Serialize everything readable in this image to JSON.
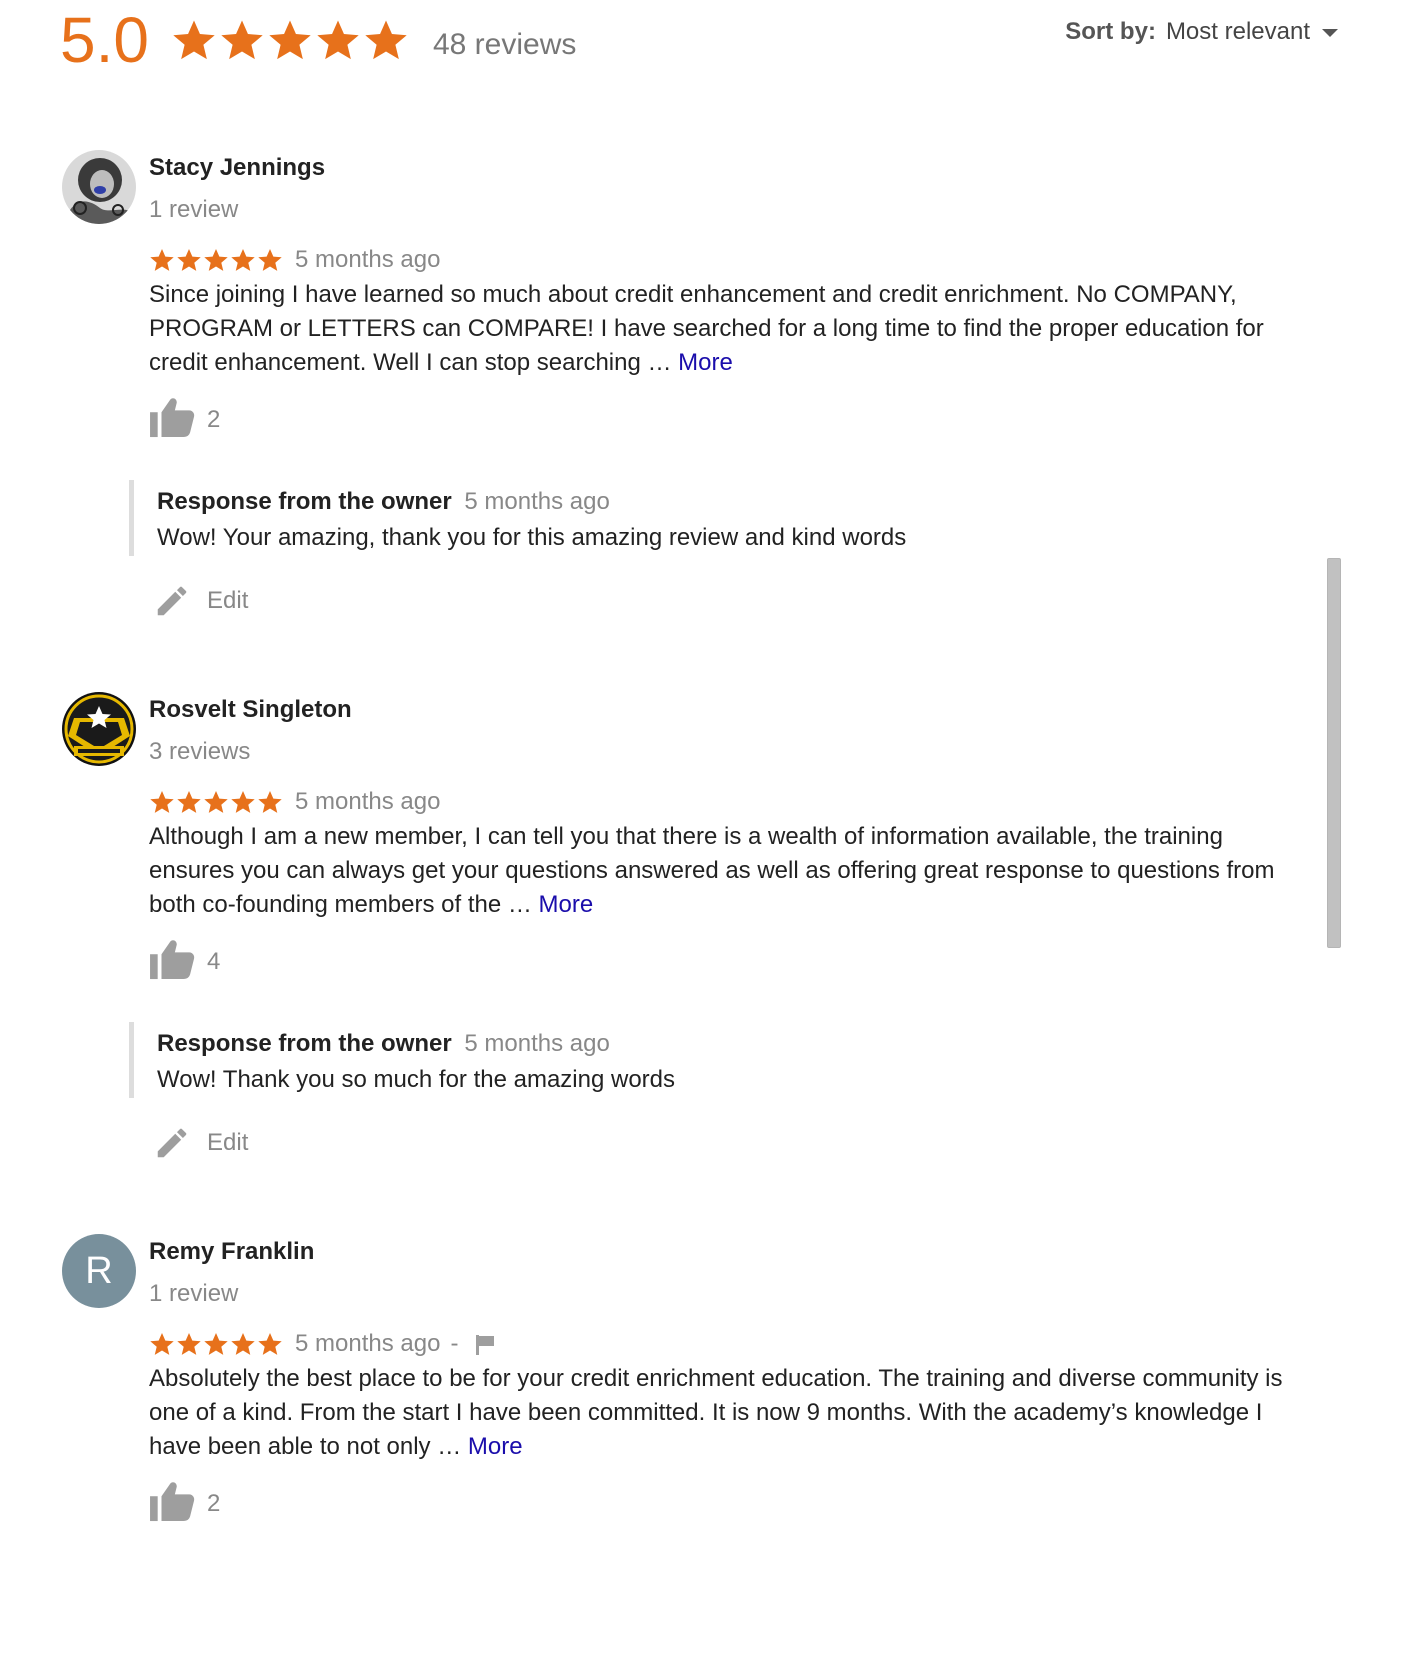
{
  "summary": {
    "score": "5.0",
    "stars": 5,
    "total_reviews": "48 reviews"
  },
  "sort": {
    "label": "Sort by:",
    "value": "Most relevant"
  },
  "colors": {
    "star": "#e7711b",
    "link": "#1a0dab",
    "muted": "#888888",
    "avatar_letter_bg": "#78909c"
  },
  "reviews": [
    {
      "name": "Stacy Jennings",
      "count": "1 review",
      "rating": 5,
      "date": "5 months ago",
      "text": "Since joining I have learned so much about credit enhancement and credit enrichment. No COMPANY, PROGRAM or LETTERS can COMPARE! I have searched for a long time to find the proper education for credit enhancement. Well I can stop searching …",
      "more": "More",
      "likes": "2",
      "response": {
        "title": "Response from the owner",
        "date": "5 months ago",
        "text": "Wow! Your amazing, thank you for this amazing review and kind words"
      },
      "edit_label": "Edit"
    },
    {
      "name": "Rosvelt Singleton",
      "count": "3 reviews",
      "rating": 5,
      "date": "5 months ago",
      "text": "Although I am a new member, I can tell you that there is a wealth of information available, the training ensures you can always get your questions answered as well as offering great response to questions from both co-founding members of the …",
      "more": "More",
      "likes": "4",
      "response": {
        "title": "Response from the owner",
        "date": "5 months ago",
        "text": "Wow! Thank you so much for the amazing words"
      },
      "edit_label": "Edit"
    },
    {
      "name": "Remy Franklin",
      "avatar_letter": "R",
      "count": "1 review",
      "rating": 5,
      "date": "5 months ago",
      "date_dash": "-",
      "text": "Absolutely the best place to be for your credit enrichment education. The training and diverse community is one of a kind. From the start I have been committed. It is now 9 months. With the academy’s knowledge I have been able to not only …",
      "more": "More",
      "likes": "2"
    }
  ]
}
